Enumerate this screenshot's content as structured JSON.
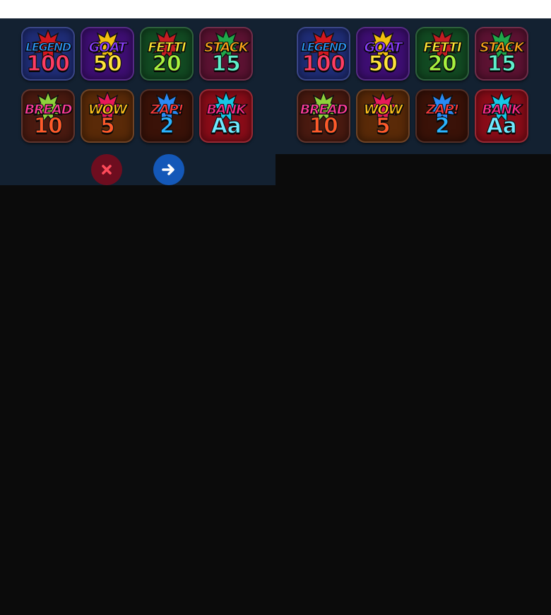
{
  "tiles": [
    {
      "word": "LEGEND",
      "value": "100",
      "bg": "#1f2d77",
      "burst": "#d4171e",
      "word_color": "#2d9bff",
      "num_color": "#ff3c63"
    },
    {
      "word": "GOAT",
      "value": "50",
      "bg": "#3e0e73",
      "burst": "#f2c00f",
      "word_color": "#8a3cff",
      "num_color": "#ffe33b"
    },
    {
      "word": "FETTI",
      "value": "20",
      "bg": "#124a22",
      "burst": "#c51d22",
      "word_color": "#ffe532",
      "num_color": "#a8f23e"
    },
    {
      "word": "STACK",
      "value": "15",
      "bg": "#5c1232",
      "burst": "#20a84a",
      "word_color": "#ffa51a",
      "num_color": "#5ff0cc"
    },
    {
      "word": "BREAD",
      "value": "10",
      "bg": "#4a1a10",
      "burst": "#8ed13b",
      "word_color": "#ff3b9a",
      "num_color": "#ff5a2a"
    },
    {
      "word": "WOW",
      "value": "5",
      "bg": "#5a2a08",
      "burst": "#e8195a",
      "word_color": "#ffc21a",
      "num_color": "#ff5a2a"
    },
    {
      "word": "ZAP!",
      "value": "2",
      "bg": "#3a1208",
      "burst": "#2a8af5",
      "word_color": "#ff3b3b",
      "num_color": "#2ab3ff"
    },
    {
      "word": "BANK",
      "value": "Aa",
      "bg": "#8a0c18",
      "burst": "#17c7e6",
      "word_color": "#ff2a8a",
      "num_color": "#6fe9ff"
    }
  ],
  "actions": {
    "close_icon": "close-icon",
    "next_icon": "arrow-right-icon",
    "close_color": "#ff4a5a",
    "next_color": "#ffffff"
  }
}
